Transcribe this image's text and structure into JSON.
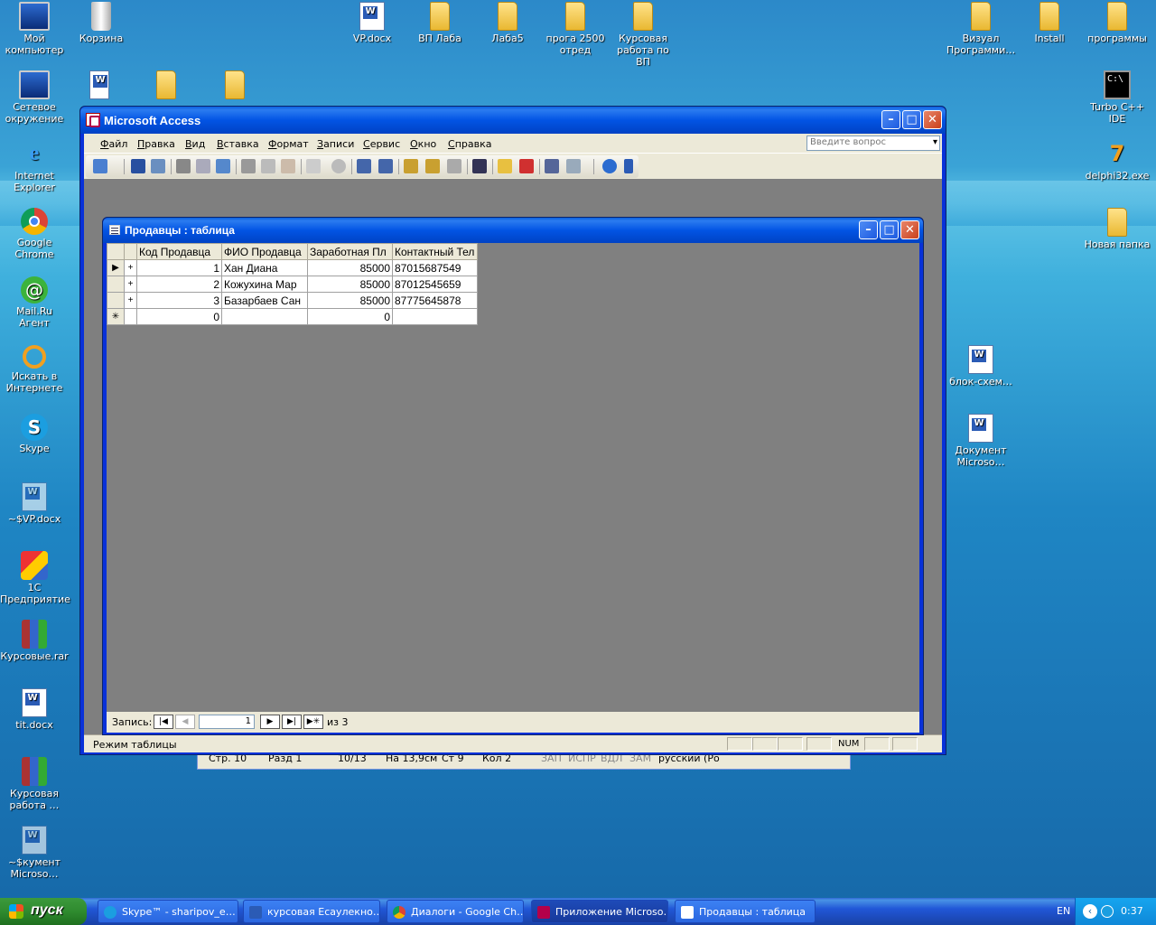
{
  "desktop": {
    "icons": [
      {
        "label": "Мой компьютер",
        "kind": "monitor"
      },
      {
        "label": "Корзина",
        "kind": "recycle"
      },
      {
        "label": "VP.docx",
        "kind": "doc"
      },
      {
        "label": "ВП Лаба",
        "kind": "folder"
      },
      {
        "label": "Лаба5",
        "kind": "folder"
      },
      {
        "label": "прога 2500 отред",
        "kind": "folder"
      },
      {
        "label": "Курсовая работа по ВП",
        "kind": "folder"
      },
      {
        "label": "Визуал Программи…",
        "kind": "folder"
      },
      {
        "label": "Install",
        "kind": "folder"
      },
      {
        "label": "программы",
        "kind": "folder"
      },
      {
        "label": "Сетевое окружение",
        "kind": "monitor"
      },
      {
        "label": "Turbo C++ IDE",
        "kind": "terminal"
      },
      {
        "label": "Internet Explorer",
        "kind": "ie"
      },
      {
        "label": "delphi32.exe",
        "kind": "delphi"
      },
      {
        "label": "Google Chrome",
        "kind": "chrome"
      },
      {
        "label": "Новая папка",
        "kind": "folder"
      },
      {
        "label": "Mail.Ru Агент",
        "kind": "mailru"
      },
      {
        "label": "Искать в Интернете",
        "kind": "search"
      },
      {
        "label": "блок-схем…",
        "kind": "doc"
      },
      {
        "label": "Skype",
        "kind": "skype"
      },
      {
        "label": "Документ Microso…",
        "kind": "doc"
      },
      {
        "label": "~$VP.docx",
        "kind": "doc"
      },
      {
        "label": "1С Предприятие",
        "kind": "1c"
      },
      {
        "label": "Курсовые.rar",
        "kind": "rar"
      },
      {
        "label": "tit.docx",
        "kind": "doc"
      },
      {
        "label": "Курсовая работа …",
        "kind": "rar"
      },
      {
        "label": "~$кумент Microso…",
        "kind": "doc"
      }
    ]
  },
  "bg_word": {
    "page": "Стр. 10",
    "section": "Разд 1",
    "pages": "10/13",
    "at": "На 13,9см",
    "line": "Ст 9",
    "col": "Кол 2",
    "flags": [
      "ЗАП",
      "ИСПР",
      "ВДЛ",
      "ЗАМ"
    ],
    "lang": "русский (Ро"
  },
  "access": {
    "title": "Microsoft Access",
    "menu": [
      "Файл",
      "Правка",
      "Вид",
      "Вставка",
      "Формат",
      "Записи",
      "Сервис",
      "Окно",
      "Справка"
    ],
    "help_placeholder": "Введите вопрос",
    "status": "Режим таблицы",
    "num": "NUM"
  },
  "table_window": {
    "title": "Продавцы : таблица",
    "columns": [
      "Код Продавца",
      "ФИО Продавца",
      "Заработная Пл",
      "Контактный Тел"
    ],
    "rows": [
      {
        "marker": "▶",
        "expand": "+",
        "id": "1",
        "name": "Хан Диана",
        "salary": "85000",
        "phone": "87015687549"
      },
      {
        "marker": "",
        "expand": "+",
        "id": "2",
        "name": "Кожухина Мар",
        "salary": "85000",
        "phone": "87012545659"
      },
      {
        "marker": "",
        "expand": "+",
        "id": "3",
        "name": "Базарбаев Сан",
        "salary": "85000",
        "phone": "87775645878"
      },
      {
        "marker": "✳",
        "expand": "",
        "id": "0",
        "name": "",
        "salary": "0",
        "phone": ""
      }
    ],
    "nav_label": "Запись:",
    "nav_current": "1",
    "nav_of": "из  3"
  },
  "taskbar": {
    "start": "пуск",
    "tasks": [
      "Skype™ - sharipov_e…",
      "курсовая Есаулекно…",
      "Диалоги - Google Ch…",
      "Приложение Microso…",
      "Продавцы : таблица"
    ],
    "lang": "EN",
    "clock": "0:37"
  }
}
